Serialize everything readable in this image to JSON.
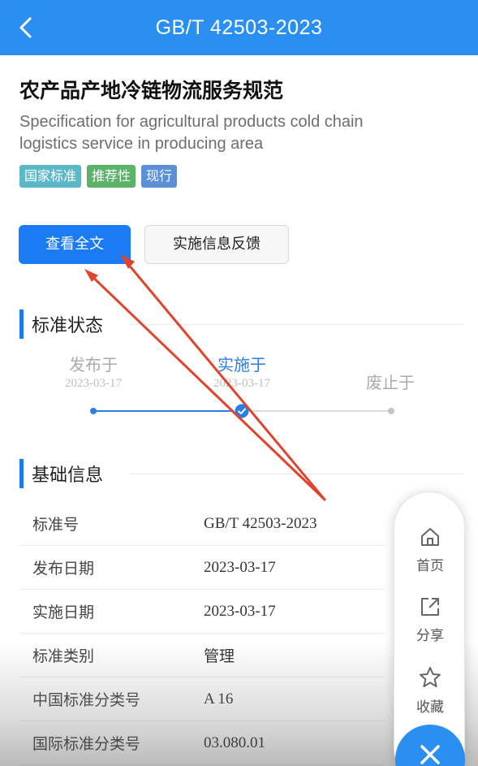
{
  "header": {
    "title": "GB/T 42503-2023"
  },
  "standard": {
    "title_cn": "农产品产地冷链物流服务规范",
    "title_en": "Specification for agricultural products cold chain logistics service in producing area",
    "tags": [
      {
        "label": "国家标准",
        "color": "#5bb8c9"
      },
      {
        "label": "推荐性",
        "color": "#5bb36a"
      },
      {
        "label": "现行",
        "color": "#5b8fd8"
      }
    ]
  },
  "actions": {
    "view_full_text": "查看全文",
    "feedback": "实施信息反馈"
  },
  "status_section": {
    "title": "标准状态",
    "steps": [
      {
        "label": "发布于",
        "date": "2023-03-17"
      },
      {
        "label": "实施于",
        "date": "2023-03-17"
      },
      {
        "label": "废止于",
        "date": ""
      }
    ],
    "active_step": 1
  },
  "basic_section": {
    "title": "基础信息",
    "rows": [
      {
        "key": "标准号",
        "value": "GB/T 42503-2023"
      },
      {
        "key": "发布日期",
        "value": "2023-03-17"
      },
      {
        "key": "实施日期",
        "value": "2023-03-17"
      },
      {
        "key": "标准类别",
        "value": "管理"
      },
      {
        "key": "中国标准分类号",
        "value": "A 16"
      },
      {
        "key": "国际标准分类号",
        "value": "03.080.01"
      }
    ]
  },
  "fab": {
    "home": "首页",
    "share": "分享",
    "favorite": "收藏"
  },
  "colors": {
    "accent": "#2a8ff0",
    "primary_button": "#1a7bf2",
    "annotation_arrow": "#e0442e"
  }
}
